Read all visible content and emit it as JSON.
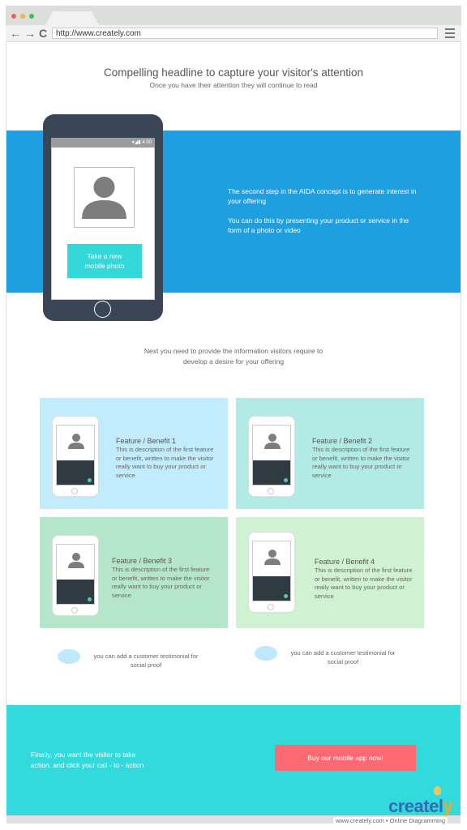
{
  "browser": {
    "url": "http://www.creately.com",
    "nav": {
      "back": "←",
      "forward": "→",
      "reload": "C"
    },
    "traffic_lights": {
      "close": "#f05b6a",
      "minimize": "#f5b83d",
      "maximize": "#35c34a"
    }
  },
  "hero": {
    "headline": "Compelling headline to capture your visitor's attention",
    "subheadline": "Once you have their attention they will continue to read"
  },
  "phone_mockup": {
    "status": "▾◢▮ 4.00",
    "button_line1": "Take a new",
    "button_line2": "mobile photo"
  },
  "interest": {
    "paragraph1": "The second step in the AIDA concept is to generate interest in your offering",
    "paragraph2": "You can do this by presenting your product or service in the form of a photo or video"
  },
  "desire": {
    "line1": "Next you need to provide the information visitors require to",
    "line2": "develop a desire for your offering"
  },
  "features": [
    {
      "title": "Feature / Benefit 1",
      "description": "This is description of the first feature or benefit, written to make the visitor really want to buy your product or service",
      "color": "#c2ebfb"
    },
    {
      "title": "Feature / Benefit 2",
      "description": "This is description of the first feature or benefit, written to make the visitor really want to buy your product or service",
      "color": "#b2ebe6"
    },
    {
      "title": "Feature / Benefit 3",
      "description": "This is description of the first feature or benefit, written to make the visitor really want to buy your product or service",
      "color": "#b6e6c9"
    },
    {
      "title": "Feature / Benefit 4",
      "description": "This is description of the first feature or benefit, written to make the visitor really want to buy your product or service",
      "color": "#d1f1d3"
    }
  ],
  "testimonials": [
    {
      "line1": "you can add a customer testimonial for",
      "line2": "social proof"
    },
    {
      "line1": "you can add a customer testimonial for",
      "line2": "social proof"
    }
  ],
  "action": {
    "line1": "Finally, you want the visitor to take",
    "line2": "action, and click your call - to - action",
    "button": "Buy our mobile app now!"
  },
  "branding": {
    "logo_main": "createl",
    "logo_end": "y",
    "credit": "www.creately.com • Online Diagramming"
  },
  "colors": {
    "blue_band": "#1ea0e0",
    "teal": "#33dadb",
    "cta_button": "#ff6a72",
    "phone_body": "#3a4556"
  }
}
